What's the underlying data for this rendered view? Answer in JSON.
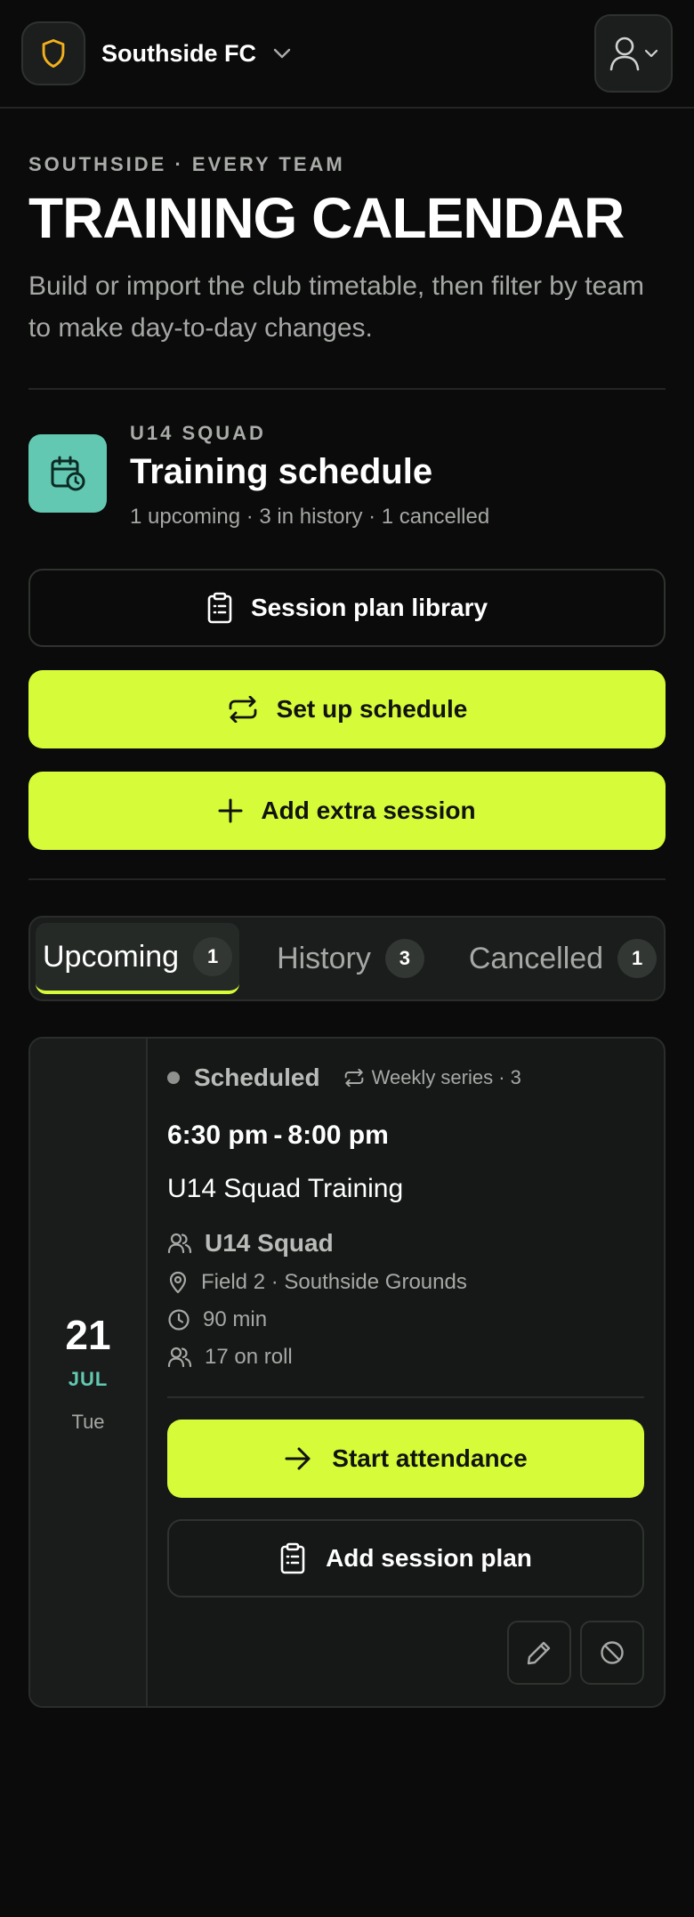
{
  "header": {
    "club_name": "Southside FC",
    "brand_color": "#f2b01e",
    "icons": {
      "club": "shield-icon",
      "switch": "chevron-down-icon",
      "profile": "user-icon"
    }
  },
  "intro": {
    "eyebrow": "SOUTHSIDE · EVERY TEAM",
    "title": "TRAINING CALENDAR",
    "subtitle": "Build or import the club timetable, then filter by team to make day-to-day changes."
  },
  "schedule": {
    "squad_label": "U14 SQUAD",
    "title": "Training schedule",
    "meta": "1 upcoming · 3 in history · 1 cancelled",
    "icon": "calendar-clock-icon",
    "accent": "#63c8b2"
  },
  "actions": {
    "library_label": "Session plan library",
    "setup_label": "Set up schedule",
    "add_extra_label": "Add extra session",
    "lime": "#d6fb38"
  },
  "tabs": [
    {
      "label": "Upcoming",
      "count": "1",
      "active": true
    },
    {
      "label": "History",
      "count": "3",
      "active": false
    },
    {
      "label": "Cancelled",
      "count": "1",
      "active": false
    }
  ],
  "session": {
    "day": "21",
    "month": "JUL",
    "weekday": "Tue",
    "status": "Scheduled",
    "series": "Weekly series · 3",
    "start_time": "6:30 pm",
    "time_sep": "-",
    "end_time": "8:00 pm",
    "title": "U14 Squad Training",
    "team": "U14 Squad",
    "location": "Field 2 · Southside Grounds",
    "duration": "90 min",
    "roll": "17 on roll",
    "start_attendance_label": "Start attendance",
    "add_plan_label": "Add session plan"
  }
}
